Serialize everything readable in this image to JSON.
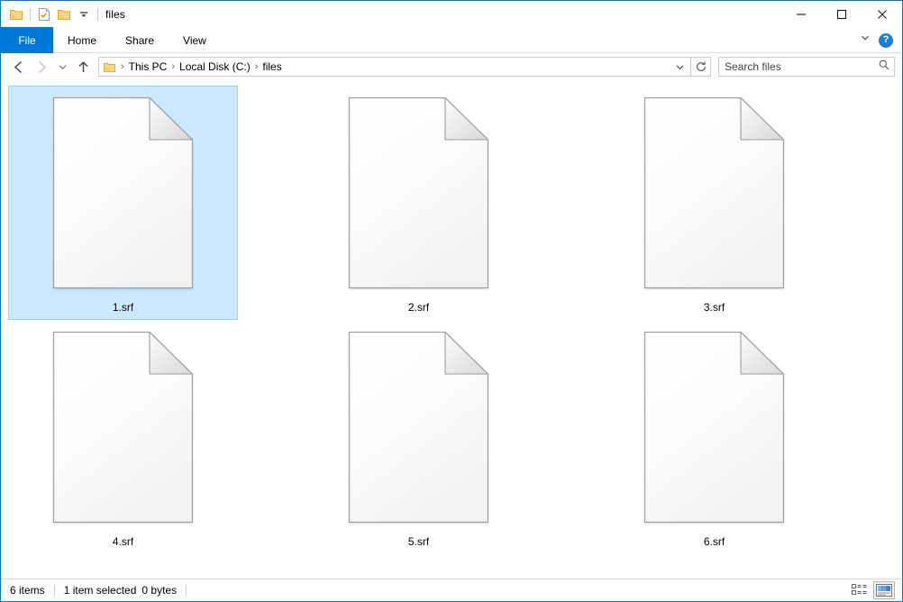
{
  "window": {
    "title": "files",
    "border_color": "#0078d7",
    "accent_color": "#0078d7"
  },
  "quick_access": {
    "items": [
      {
        "name": "folder-icon",
        "label": "Folder"
      },
      {
        "name": "properties-icon",
        "label": "Properties"
      },
      {
        "name": "new-folder-icon",
        "label": "New folder"
      },
      {
        "name": "chevron-down-icon",
        "label": "Customize Quick Access Toolbar"
      }
    ]
  },
  "window_controls": {
    "minimize": "—",
    "maximize": "□",
    "close": "✕"
  },
  "ribbon": {
    "tabs": [
      {
        "label": "File",
        "active": true
      },
      {
        "label": "Home",
        "active": false
      },
      {
        "label": "Share",
        "active": false
      },
      {
        "label": "View",
        "active": false
      }
    ],
    "collapse_label": "⌄",
    "help_label": "?"
  },
  "address_bar": {
    "back_label": "←",
    "forward_label": "→",
    "recent_label": "⌄",
    "up_label": "↑",
    "breadcrumbs": [
      {
        "label": "This PC"
      },
      {
        "label": "Local Disk (C:)"
      },
      {
        "label": "files"
      }
    ],
    "separator": "›",
    "dropdown_label": "⌄",
    "refresh_label": "↻"
  },
  "search": {
    "placeholder": "Search files",
    "value": "",
    "icon": "search-icon"
  },
  "files": [
    {
      "name": "1.srf",
      "selected": true
    },
    {
      "name": "2.srf",
      "selected": false
    },
    {
      "name": "3.srf",
      "selected": false
    },
    {
      "name": "4.srf",
      "selected": false
    },
    {
      "name": "5.srf",
      "selected": false
    },
    {
      "name": "6.srf",
      "selected": false
    }
  ],
  "status_bar": {
    "item_count": "6 items",
    "selection": "1 item selected",
    "size": "0 bytes"
  },
  "view_buttons": [
    {
      "name": "details-view-button",
      "active": false
    },
    {
      "name": "large-icons-view-button",
      "active": true
    }
  ]
}
